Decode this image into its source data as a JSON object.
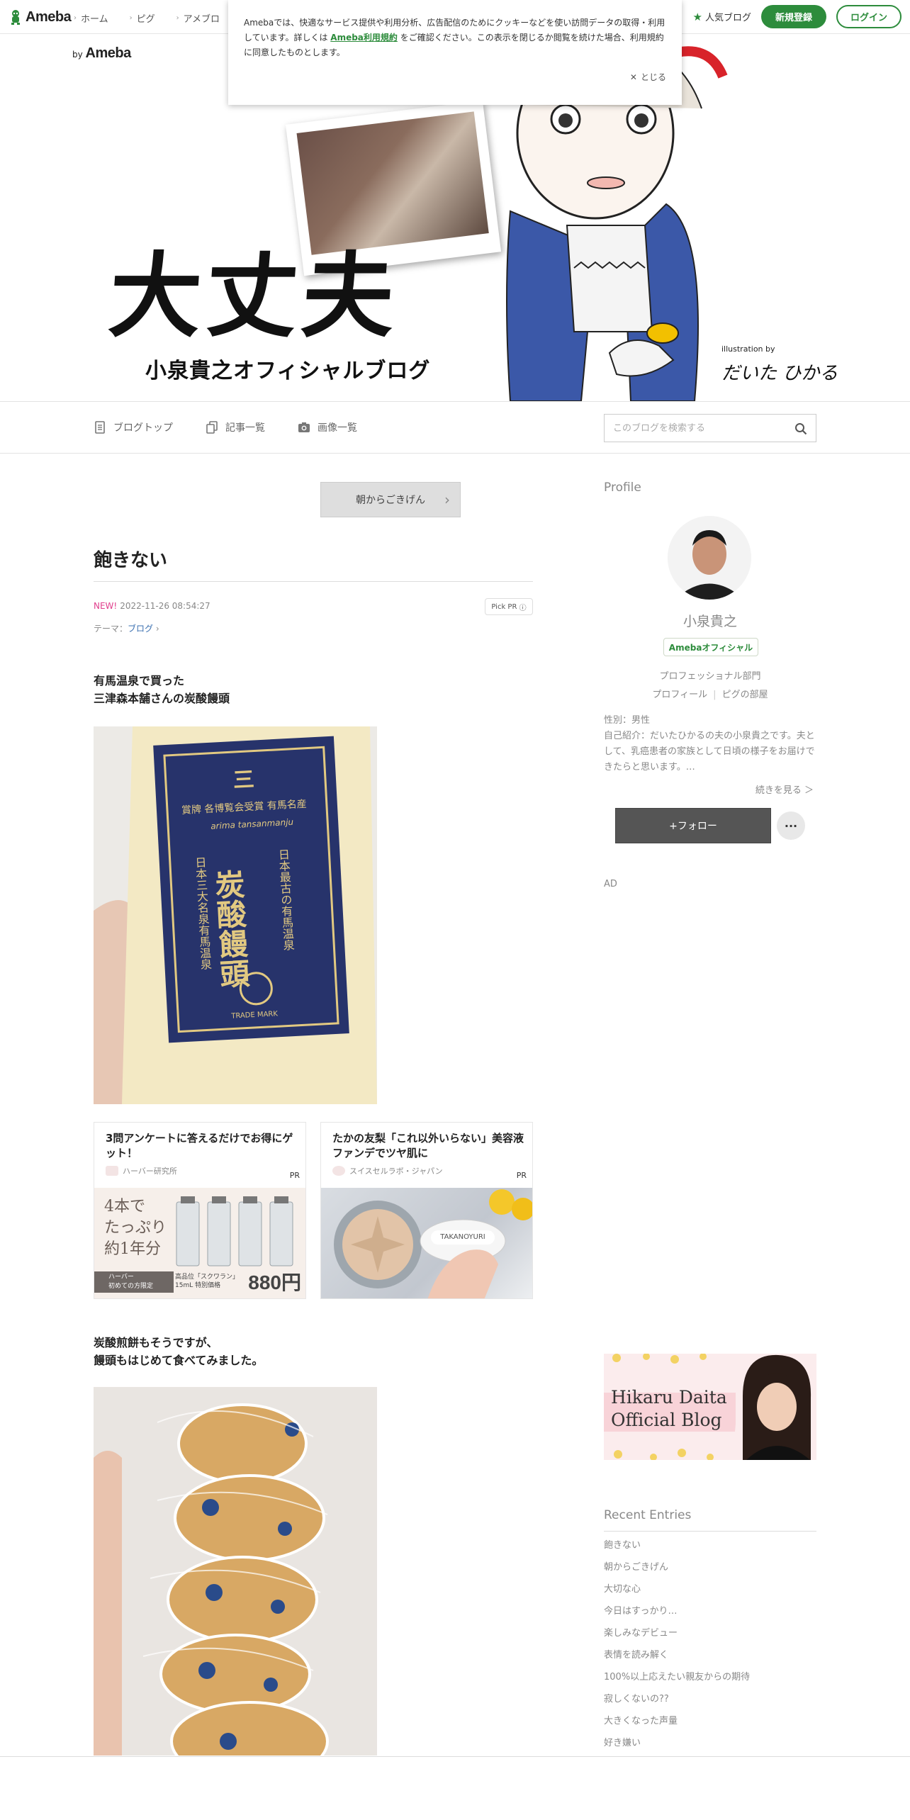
{
  "global_header": {
    "logo_text": "Ameba",
    "nav": [
      {
        "label": "ホーム"
      },
      {
        "label": "ピグ"
      },
      {
        "label": "アメブロ"
      }
    ],
    "popular_label": "人気ブログ",
    "register_label": "新規登録",
    "login_label": "ログイン"
  },
  "cookie_banner": {
    "text_before": "Amebaでは、快適なサービス提供や利用分析、広告配信のためにクッキーなどを使い訪問データの取得・利用しています。詳しくは",
    "link_text": "Ameba利用規約",
    "text_after": "をご確認ください。この表示を閉じるか閲覧を続けた場合、利用規約に同意したものとします。",
    "close_label": "とじる"
  },
  "blog_header": {
    "by_prefix": "by",
    "by_brand": "Ameba",
    "title": "大丈夫",
    "subtitle": "小泉貴之オフィシャルブログ",
    "illustration_credit": "illustration by",
    "illustrator": "だいた ひかる"
  },
  "blog_nav": {
    "items": [
      {
        "label": "ブログトップ",
        "icon": "document-icon"
      },
      {
        "label": "記事一覧",
        "icon": "copy-icon"
      },
      {
        "label": "画像一覧",
        "icon": "camera-icon"
      }
    ],
    "search_placeholder": "このブログを検索する"
  },
  "entry": {
    "prev_entry_label": "朝からごきげん",
    "title": "飽きない",
    "new_badge": "NEW!",
    "datetime": "2022-11-26 08:54:27",
    "pick_pr": "Pick PR",
    "theme_label": "テーマ：",
    "theme_value": "ブログ",
    "paragraph1_line1": "有馬温泉で買った",
    "paragraph1_line2": "三津森本舗さんの炭酸饅頭",
    "paragraph2_line1": "炭酸煎餅もそうですが、",
    "paragraph2_line2": "饅頭もはじめて食べてみました。",
    "photo1_text": {
      "top": "三",
      "line1": "賞牌 各博覧会受賞 有馬名産",
      "romaji": "arima tansanmanju",
      "main": "炭酸饅頭",
      "side1": "日本最古の有馬温泉",
      "side2": "日本三大名泉有馬温泉",
      "trademark": "TRADE MARK"
    }
  },
  "ads": [
    {
      "title": "3問アンケートに答えるだけでお得にゲット！",
      "sponsor": "ハーバー研究所",
      "pr": "PR",
      "big_text_1": "4本で",
      "big_text_2": "たっぷり",
      "big_text_3": "約1年分",
      "tag_line1": "ハーバー",
      "tag_line2": "初めての方限定",
      "tag_product": "高品位「スクワラン」",
      "tag_size": "15mL",
      "tag_special": "特別価格",
      "price": "880円"
    },
    {
      "title": "たかの友梨「これ以外いらない」美容液ファンデでツヤ肌に",
      "sponsor": "スイスセルラボ・ジャパン",
      "pr": "PR",
      "brand_label": "TAKANOYURI"
    }
  ],
  "sidebar": {
    "profile_heading": "Profile",
    "name": "小泉貴之",
    "official_badge": "Amebaオフィシャル",
    "category": "プロフェッショナル部門",
    "link_profile": "プロフィール",
    "link_pig": "ピグの部屋",
    "gender": "性別：男性",
    "intro": "自己紹介：だいたひかるの夫の小泉貴之です。夫として、乳癌患者の家族として日頃の様子をお届けできたらと思います。…",
    "read_more": "続きを見る ＞",
    "follow_label": "+フォロー",
    "more_label": "···",
    "ad_label": "AD",
    "banner_line1": "Hikaru Daita",
    "banner_line2": "Official Blog",
    "recent_heading": "Recent Entries",
    "recent_entries": [
      "飽きない",
      "朝からごきげん",
      "大切な心",
      "今日はすっかり…",
      "楽しみなデビュー",
      "表情を読み解く",
      "100%以上応えたい親友からの期待",
      "寂しくないの??",
      "大きくなった声量",
      "好き嫌い"
    ]
  },
  "colors": {
    "brand_green": "#2d8c3c",
    "new_badge": "#e03e8c",
    "link_blue": "#3a6fb0"
  }
}
